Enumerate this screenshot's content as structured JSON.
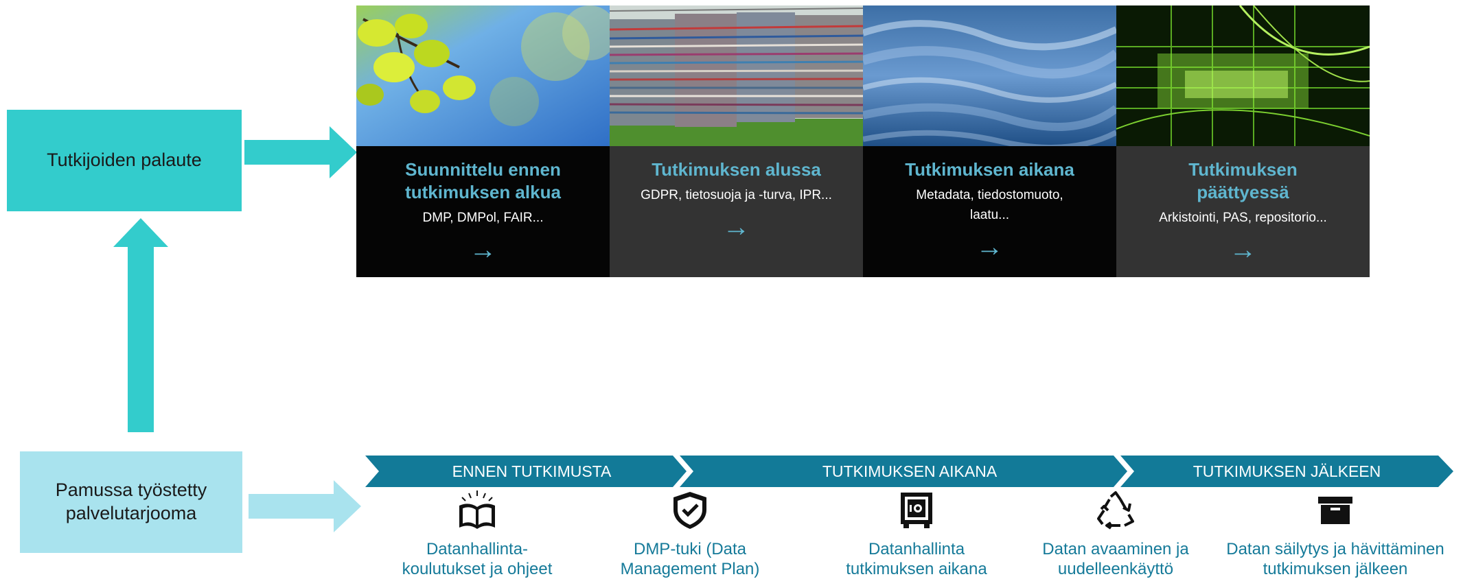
{
  "left": {
    "feedback": "Tutkijoiden palaute",
    "offering": "Pamussa työstetty palvelutarjooma"
  },
  "cards": [
    {
      "title": "Suunnittelu ennen tutkimuksen alkua",
      "subtitle": "DMP, DMPol, FAIR...",
      "arrow": "→"
    },
    {
      "title": "Tutkimuksen alussa",
      "subtitle": "GDPR, tietosuoja ja -turva, IPR...",
      "arrow": "→"
    },
    {
      "title": "Tutkimuksen aikana",
      "subtitle": "Metadata, tiedostomuoto, laatu...",
      "arrow": "→"
    },
    {
      "title": "Tutkimuksen päättyessä",
      "subtitle": "Arkistointi, PAS, repositorio...",
      "arrow": "→"
    }
  ],
  "phases": [
    "ENNEN TUTKIMUSTA",
    "TUTKIMUKSEN AIKANA",
    "TUTKIMUKSEN JÄLKEEN"
  ],
  "services": [
    {
      "icon": "open-book-icon",
      "label": "Datanhallinta-koulutukset ja ohjeet"
    },
    {
      "icon": "shield-check-icon",
      "label": "DMP-tuki (Data Management Plan)"
    },
    {
      "icon": "safe-icon",
      "label": "Datanhallinta tutkimuksen aikana"
    },
    {
      "icon": "recycle-icon",
      "label": "Datan avaaminen ja uudelleenkäyttö"
    },
    {
      "icon": "archive-box-icon",
      "label": "Datan säilytys ja hävittäminen tutkimuksen jälkeen"
    }
  ],
  "colors": {
    "feedback_box": "#33cccc",
    "offering_box": "#a9e3ee",
    "card_dark": "#050505",
    "card_gray": "#333333",
    "card_title": "#5fb6cf",
    "phase_band": "#127a98",
    "service_text": "#157a99"
  }
}
